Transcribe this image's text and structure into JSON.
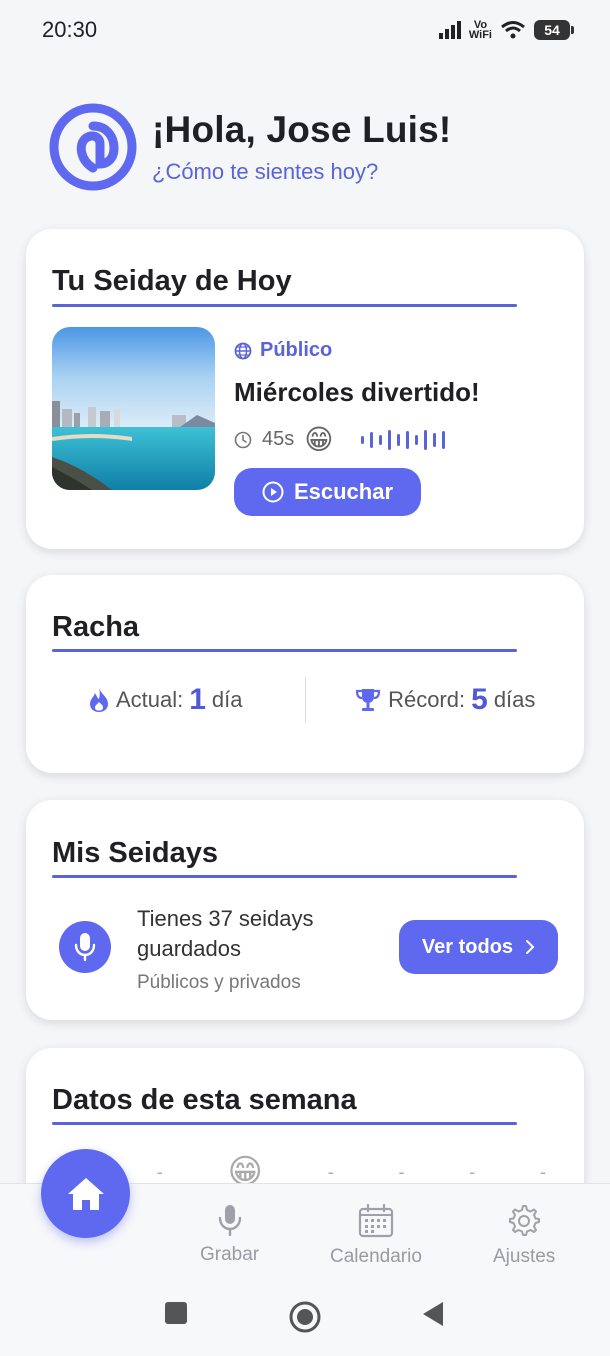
{
  "status_bar": {
    "time": "20:30",
    "wifi_label_top": "Vo",
    "wifi_label_bottom": "WiFi",
    "battery": "54"
  },
  "header": {
    "greeting": "¡Hola, Jose Luis!",
    "subtitle": "¿Cómo te sientes hoy?"
  },
  "today_card": {
    "title": "Tu Seiday de Hoy",
    "visibility": "Público",
    "seiday_title": "Miércoles divertido!",
    "duration": "45s",
    "mood_emoji": "😁",
    "listen_label": "Escuchar"
  },
  "streak_card": {
    "title": "Racha",
    "current_label": "Actual:",
    "current_value": "1",
    "current_unit": "día",
    "record_label": "Récord:",
    "record_value": "5",
    "record_unit": "días"
  },
  "seidays_card": {
    "title": "Mis Seidays",
    "saved_text": "Tienes 37 seidays guardados",
    "saved_sub": "Públicos y privados",
    "see_all_label": "Ver todos"
  },
  "week_card": {
    "title": "Datos de esta semana",
    "day_marks": [
      "-",
      "-",
      "😁",
      "-",
      "-",
      "-",
      "-"
    ]
  },
  "bottom_nav": {
    "record": "Grabar",
    "calendar": "Calendario",
    "settings": "Ajustes"
  },
  "colors": {
    "accent": "#5f69ef",
    "accent_text": "#5a64d8",
    "background": "#f5f6f8"
  }
}
